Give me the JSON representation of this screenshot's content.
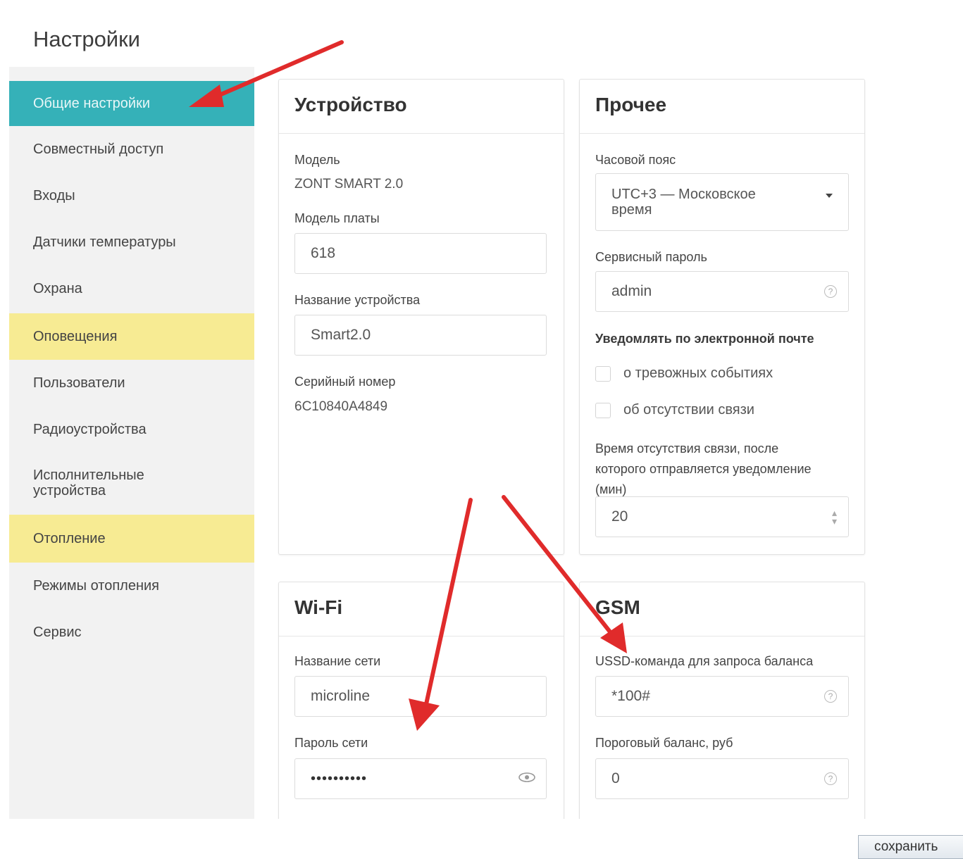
{
  "page": {
    "title": "Настройки"
  },
  "sidebar": {
    "items": [
      {
        "label": "Общие настройки"
      },
      {
        "label": "Совместный доступ"
      },
      {
        "label": "Входы"
      },
      {
        "label": "Датчики температуры"
      },
      {
        "label": "Охрана"
      },
      {
        "label": "Оповещения"
      },
      {
        "label": "Пользователи"
      },
      {
        "label": "Радиоустройства"
      },
      {
        "label": "Исполнительные устройства"
      },
      {
        "label": "Отопление"
      },
      {
        "label": "Режимы отопления"
      },
      {
        "label": "Сервис"
      }
    ]
  },
  "device": {
    "title": "Устройство",
    "model_label": "Модель",
    "model_value": "ZONT SMART 2.0",
    "board_label": "Модель платы",
    "board_value": "618",
    "name_label": "Название устройства",
    "name_value": "Smart2.0",
    "serial_label": "Серийный номер",
    "serial_value": "6C10840A4849"
  },
  "other": {
    "title": "Прочее",
    "timezone_label": "Часовой пояс",
    "timezone_value": "UTC+3 — Московское время",
    "service_password_label": "Сервисный пароль",
    "service_password_value": "admin",
    "email_notify_label": "Уведомлять по электронной почте",
    "alarm_events_label": "о тревожных событиях",
    "no_connection_label": "об отсутствии связи",
    "no_connection_time_label": "Время отсутствия связи, после которого отправляется уведомление (мин)",
    "no_connection_time_value": "20"
  },
  "wifi": {
    "title": "Wi-Fi",
    "ssid_label": "Название сети",
    "ssid_value": "microline",
    "password_label": "Пароль сети",
    "password_value": "••••••••••"
  },
  "gsm": {
    "title": "GSM",
    "ussd_label": "USSD-команда для запроса баланса",
    "ussd_value": "*100#",
    "threshold_label": "Пороговый баланс, руб",
    "threshold_value": "0"
  },
  "actions": {
    "save_label": "сохранить"
  },
  "icons": {
    "help": "help-circle-icon",
    "eye": "eye-icon",
    "spin": "spinner-icon",
    "caret": "caret-down-icon",
    "arrow": "annotation-arrow"
  },
  "colors": {
    "active": "#35b1b8",
    "warn": "#f7eb93",
    "arrow": "#e02b2b"
  }
}
